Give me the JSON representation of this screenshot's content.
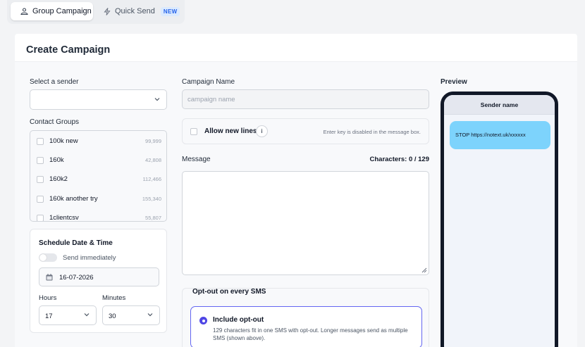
{
  "tabs": [
    {
      "label": "Group Campaign",
      "icon": "users-icon",
      "active": true
    },
    {
      "label": "Quick Send",
      "icon": "bolt-icon",
      "badge": "NEW",
      "active": false
    }
  ],
  "page": {
    "title": "Create Campaign"
  },
  "sender": {
    "label": "Select a sender",
    "value": ""
  },
  "contact_groups": {
    "label": "Contact Groups",
    "items": [
      {
        "name": "100k new",
        "count": "99,999"
      },
      {
        "name": "160k",
        "count": "42,808"
      },
      {
        "name": "160k2",
        "count": "112,466"
      },
      {
        "name": "160k another try",
        "count": "155,340"
      },
      {
        "name": "1clientcsv",
        "count": "55,807"
      }
    ]
  },
  "schedule": {
    "title": "Schedule Date & Time",
    "send_immediately_label": "Send immediately",
    "send_immediately": false,
    "date": "16-07-2026",
    "hours_label": "Hours",
    "hours_value": "17",
    "minutes_label": "Minutes",
    "minutes_value": "30"
  },
  "campaign_name": {
    "label": "Campaign Name",
    "placeholder": "campaign name",
    "value": ""
  },
  "allow_new_lines": {
    "label": "Allow new lines",
    "info": "i",
    "hint": "Enter key is disabled in the message box."
  },
  "message": {
    "label": "Message",
    "char_count": "Characters: 0 / 129",
    "value": ""
  },
  "optout": {
    "title": "Opt-out on every SMS",
    "option_title": "Include opt-out",
    "option_desc": "129 characters fit in one SMS with opt-out. Longer messages send as multiple SMS (shown above)."
  },
  "preview": {
    "label": "Preview",
    "sender_name": "Sender name",
    "message_text": "STOP https://notext.uk/xxxxxx"
  },
  "colors": {
    "accent": "#4f46e5",
    "bubble": "#7dd3fc",
    "badge": "#2563eb"
  }
}
